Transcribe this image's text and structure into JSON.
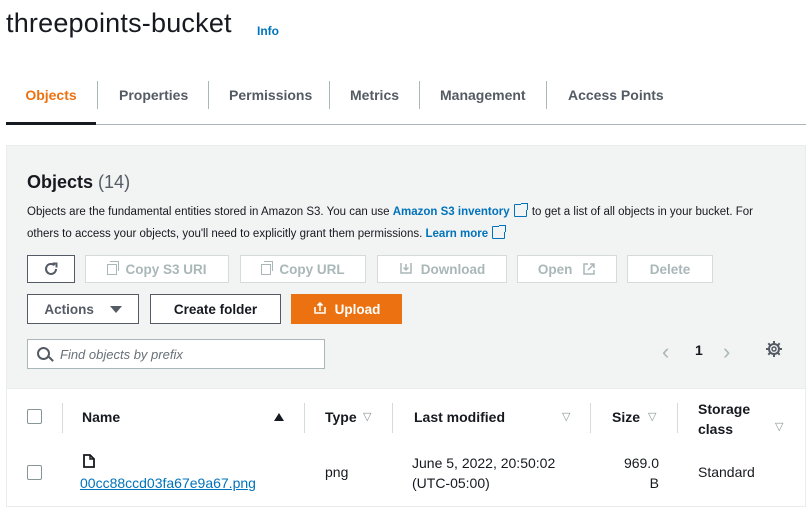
{
  "header": {
    "title": "threepoints-bucket",
    "info_label": "Info"
  },
  "tabs": [
    {
      "label": "Objects",
      "active": true
    },
    {
      "label": "Properties",
      "active": false
    },
    {
      "label": "Permissions",
      "active": false
    },
    {
      "label": "Metrics",
      "active": false
    },
    {
      "label": "Management",
      "active": false
    },
    {
      "label": "Access Points",
      "active": false
    }
  ],
  "objects": {
    "heading": "Objects",
    "count": "(14)",
    "description_1": "Objects are the fundamental entities stored in Amazon S3. You can use",
    "inventory_link": "Amazon S3 inventory",
    "description_2": "to get a list of all objects in your bucket. For others to access your objects, you'll need to explicitly grant them permissions.",
    "learn_more": "Learn more"
  },
  "toolbar": {
    "copy_uri": "Copy S3 URI",
    "copy_url": "Copy URL",
    "download": "Download",
    "open": "Open",
    "delete": "Delete",
    "actions": "Actions",
    "create_folder": "Create folder",
    "upload": "Upload"
  },
  "search": {
    "placeholder": "Find objects by prefix"
  },
  "pagination": {
    "page": "1"
  },
  "table": {
    "columns": {
      "name": "Name",
      "type": "Type",
      "last_modified": "Last modified",
      "size": "Size",
      "storage_class_1": "Storage",
      "storage_class_2": "class"
    },
    "rows": [
      {
        "name": "00cc88ccd03fa67e9a67.png",
        "type": "png",
        "modified_1": "June 5, 2022, 20:50:02",
        "modified_2": "(UTC-05:00)",
        "size_1": "969.0",
        "size_2": "B",
        "storage_class": "Standard"
      }
    ]
  },
  "colors": {
    "accent": "#ec7211",
    "link": "#0073bb"
  }
}
